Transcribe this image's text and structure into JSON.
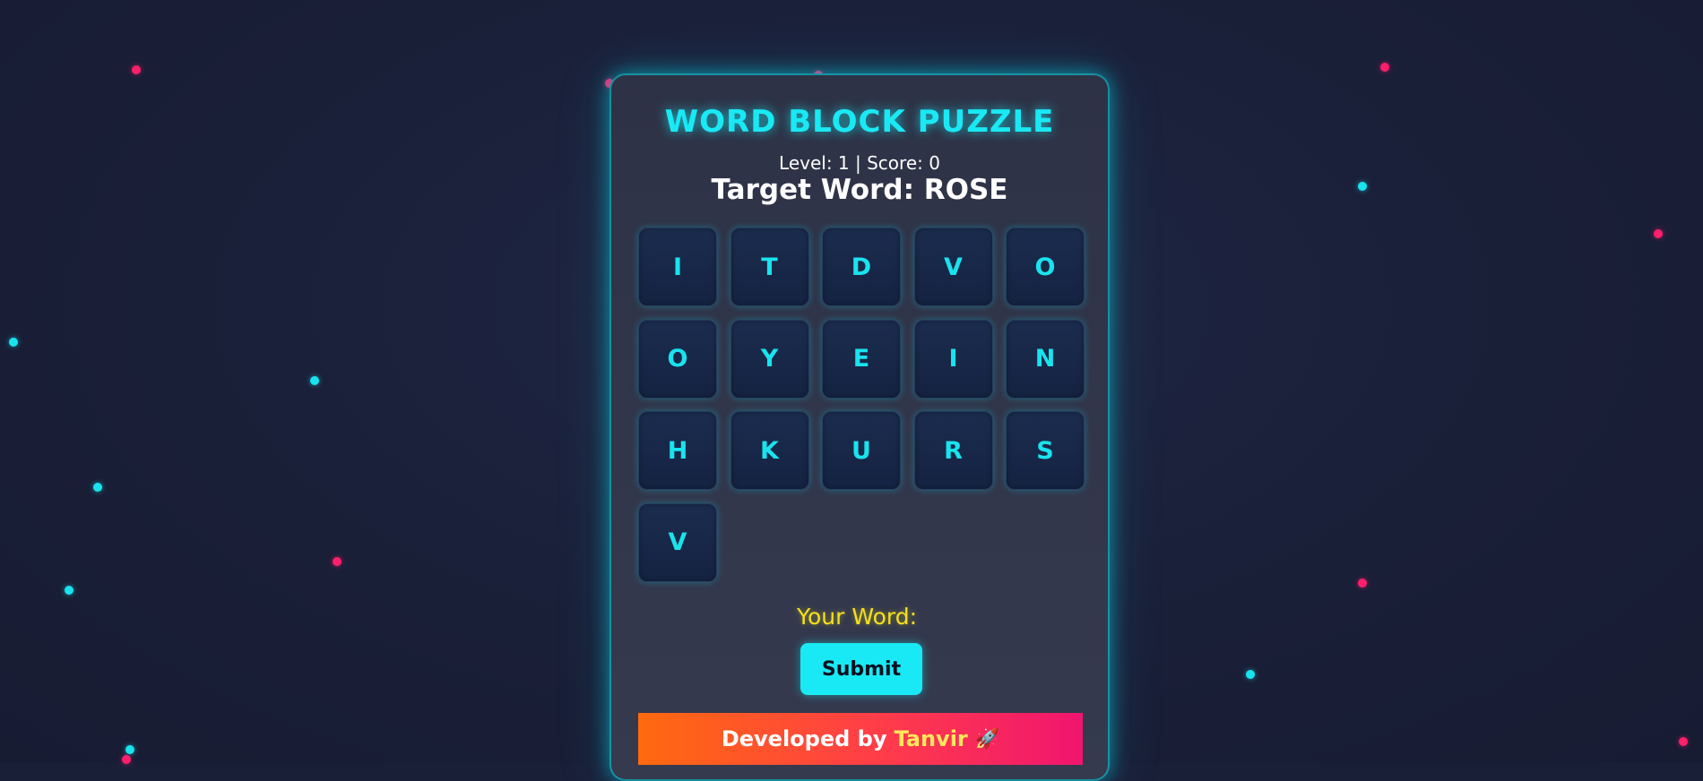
{
  "game": {
    "title": "WORD BLOCK PUZZLE",
    "stats": "Level: 1 | Score: 0",
    "target_label": "Target Word: ROSE",
    "letters": [
      "I",
      "T",
      "D",
      "V",
      "O",
      "O",
      "Y",
      "E",
      "I",
      "N",
      "H",
      "K",
      "U",
      "R",
      "S",
      "V"
    ],
    "your_word_label": "Your Word:",
    "your_word_value": "",
    "submit_label": "Submit"
  },
  "footer": {
    "prefix": "Developed by",
    "author": "Tanvir",
    "rocket_icon": "rocket-icon"
  },
  "colors": {
    "background": "#1a1f38",
    "accent_cyan": "#19e9f4",
    "accent_pink": "#ff1f6b",
    "your_word_yellow": "#f4e01c",
    "footer_gradient_start": "#ff6a0e",
    "footer_gradient_end": "#f0156f"
  }
}
